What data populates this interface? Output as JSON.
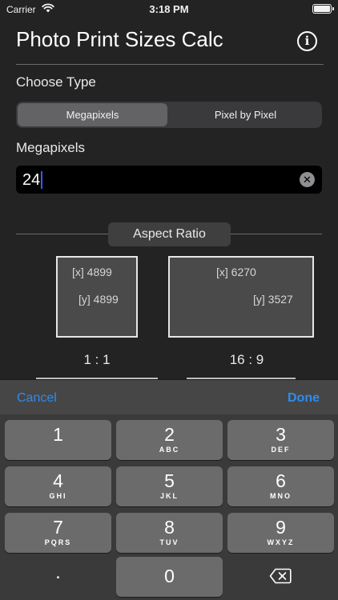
{
  "status_bar": {
    "carrier": "Carrier",
    "time": "3:18 PM",
    "wifi_icon": "wifi-icon",
    "battery_icon": "battery-icon"
  },
  "header": {
    "title": "Photo Print Sizes Calc",
    "info_icon": "info-icon"
  },
  "choose_type": {
    "label": "Choose Type",
    "segments": [
      {
        "label": "Megapixels",
        "selected": true
      },
      {
        "label": "Pixel by Pixel",
        "selected": false
      }
    ]
  },
  "megapixels": {
    "label": "Megapixels",
    "value": "24",
    "clear_icon": "clear-icon"
  },
  "aspect_ratio": {
    "title": "Aspect Ratio",
    "items": [
      {
        "label": "1 : 1",
        "x_text": "[x] 4899",
        "y_text": "[y] 4899"
      },
      {
        "label": "16 : 9",
        "x_text": "[x] 6270",
        "y_text": "[y] 3527"
      }
    ]
  },
  "keyboard": {
    "cancel": "Cancel",
    "done": "Done",
    "keys": [
      {
        "num": "1",
        "letters": ""
      },
      {
        "num": "2",
        "letters": "ABC"
      },
      {
        "num": "3",
        "letters": "DEF"
      },
      {
        "num": "4",
        "letters": "GHI"
      },
      {
        "num": "5",
        "letters": "JKL"
      },
      {
        "num": "6",
        "letters": "MNO"
      },
      {
        "num": "7",
        "letters": "PQRS"
      },
      {
        "num": "8",
        "letters": "TUV"
      },
      {
        "num": "9",
        "letters": "WXYZ"
      }
    ],
    "decimal": ".",
    "zero": "0",
    "delete_icon": "delete-icon"
  },
  "colors": {
    "background": "#232323",
    "accent": "#2d8cf0",
    "caret": "#3c5bff"
  }
}
